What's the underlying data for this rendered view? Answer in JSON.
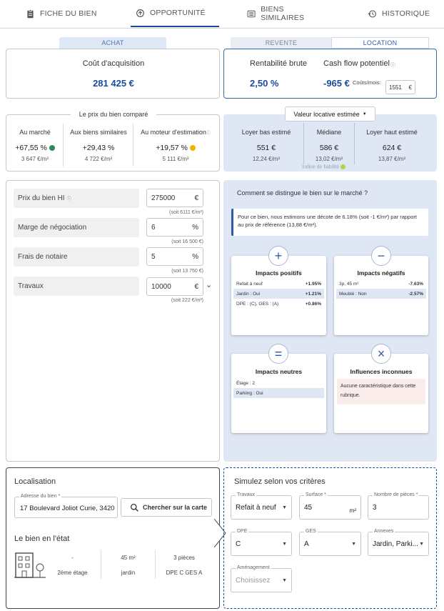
{
  "tabs": [
    {
      "label": "FICHE DU BIEN",
      "icon": "clipboard-icon"
    },
    {
      "label": "OPPORTUNITÉ",
      "icon": "cycle-icon"
    },
    {
      "label": "BIENS SIMILAIRES",
      "icon": "list-icon"
    },
    {
      "label": "HISTORIQUE",
      "icon": "history-icon"
    }
  ],
  "seg": {
    "achat": "ACHAT",
    "revente": "REVENTE",
    "location": "LOCATION"
  },
  "acquisition": {
    "title": "Coût d'acquisition",
    "value": "281 425 €"
  },
  "rentab": {
    "title": "Rentabilité brute",
    "value": "2,50 %"
  },
  "cashflow": {
    "title": "Cash flow potentiel",
    "value": "-965 €",
    "couts_label": "Coûts/mois:",
    "couts_value": "1551",
    "couts_unit": "€"
  },
  "compare": {
    "title": "Le prix du bien comparé",
    "cols": [
      {
        "label": "Au marché",
        "pct": "+67,55 %",
        "sub": "3 647 €/m²",
        "dot": "#2e8b57"
      },
      {
        "label": "Aux biens similaires",
        "pct": "+29,43 %",
        "sub": "4 722 €/m²"
      },
      {
        "label": "Au moteur d'estimation",
        "pct": "+19,57 %",
        "sub": "5 111 €/m²",
        "dot": "#f0b400"
      }
    ]
  },
  "valeur": {
    "dropdown": "Valeur locative estimée",
    "cols": [
      {
        "label": "Loyer bas estimé",
        "value": "551 €",
        "sub": "12,24 €/m²"
      },
      {
        "label": "Médiane",
        "value": "586 €",
        "sub": "13,02 €/m²"
      },
      {
        "label": "Loyer haut estimé",
        "value": "624 €",
        "sub": "13,87 €/m²"
      }
    ],
    "fiabilite": "Indice de fiabilité"
  },
  "form": {
    "rows": [
      {
        "label": "Prix du bien HI",
        "value": "275000",
        "unit": "€",
        "note": "(soit 6111 €/m²)"
      },
      {
        "label": "Marge de négociation",
        "value": "6",
        "unit": "%",
        "note": "(soit 16 500 €)"
      },
      {
        "label": "Frais de notaire",
        "value": "5",
        "unit": "%",
        "note": "(soit 13 750 €)"
      },
      {
        "label": "Travaux",
        "value": "10000",
        "unit": "€",
        "note": "(soit 222 €/m²)"
      }
    ]
  },
  "distingue": {
    "title": "Comment se distingue le bien sur le marché ?",
    "info": "Pour ce bien, nous estimons une décote de 6.18% (soit -1 €/m²) par rapport au prix de référence (13,88 €/m²).",
    "positifs": {
      "title": "Impacts positifs",
      "rows": [
        {
          "k": "Refait à neuf",
          "v": "+1.95%"
        },
        {
          "k": "Jardin : Oui",
          "v": "+1.21%"
        },
        {
          "k": "DPE : (C), GES : (A)",
          "v": "+0.86%"
        }
      ]
    },
    "negatifs": {
      "title": "Impacts négatifs",
      "rows": [
        {
          "k": "3p, 45 m²",
          "v": "-7.63%"
        },
        {
          "k": "Meublé : Non",
          "v": "-2.57%"
        }
      ]
    },
    "neutres": {
      "title": "Impacts neutres",
      "rows": [
        {
          "k": "Étage : 2"
        },
        {
          "k": "Parking : Oui"
        }
      ]
    },
    "inconnues": {
      "title": "Influences inconnues",
      "text": "Aucune caractéristique dans cette rubrique."
    }
  },
  "localisation": {
    "title": "Localisation",
    "addr_label": "Adresse du bien *",
    "addr_value": "17 Boulevard Joliot Curie, 3420",
    "search_btn": "Chercher sur la carte",
    "etat_title": "Le bien en l'état",
    "etat": [
      {
        "top": "-",
        "bottom": "2ème étage"
      },
      {
        "top": "45 m²",
        "bottom": "jardin"
      },
      {
        "top": "3 pièces",
        "bottom": "DPE C  GES A"
      }
    ]
  },
  "simulez": {
    "title": "Simulez selon vos critères",
    "fields": [
      {
        "label": "Travaux",
        "value": "Refait à neuf",
        "type": "select"
      },
      {
        "label": "Surface *",
        "value": "45",
        "unit": "m²",
        "type": "input"
      },
      {
        "label": "Nombre de pièces *",
        "value": "3",
        "type": "input"
      },
      {
        "label": "DPE",
        "value": "C",
        "type": "select"
      },
      {
        "label": "GES",
        "value": "A",
        "type": "select"
      },
      {
        "label": "Annexes",
        "value": "Jardin, Parki...",
        "type": "select"
      },
      {
        "label": "Aménagement",
        "value": "Choisissez",
        "type": "select-placeholder"
      }
    ]
  }
}
